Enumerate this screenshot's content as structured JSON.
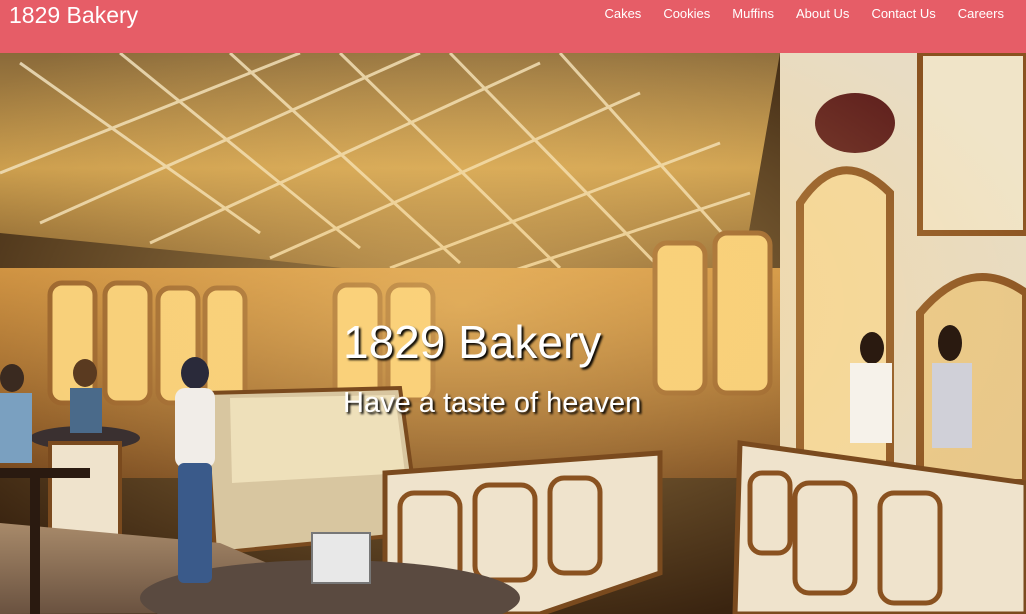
{
  "navbar": {
    "brand": "1829 Bakery",
    "links": [
      {
        "label": "Cakes"
      },
      {
        "label": "Cookies"
      },
      {
        "label": "Muffins"
      },
      {
        "label": "About Us"
      },
      {
        "label": "Contact Us"
      },
      {
        "label": "Careers"
      }
    ]
  },
  "hero": {
    "title": "1829 Bakery",
    "subtitle": "Have a taste of heaven"
  },
  "colors": {
    "navbar_bg": "#e65d67",
    "text": "#ffffff"
  }
}
